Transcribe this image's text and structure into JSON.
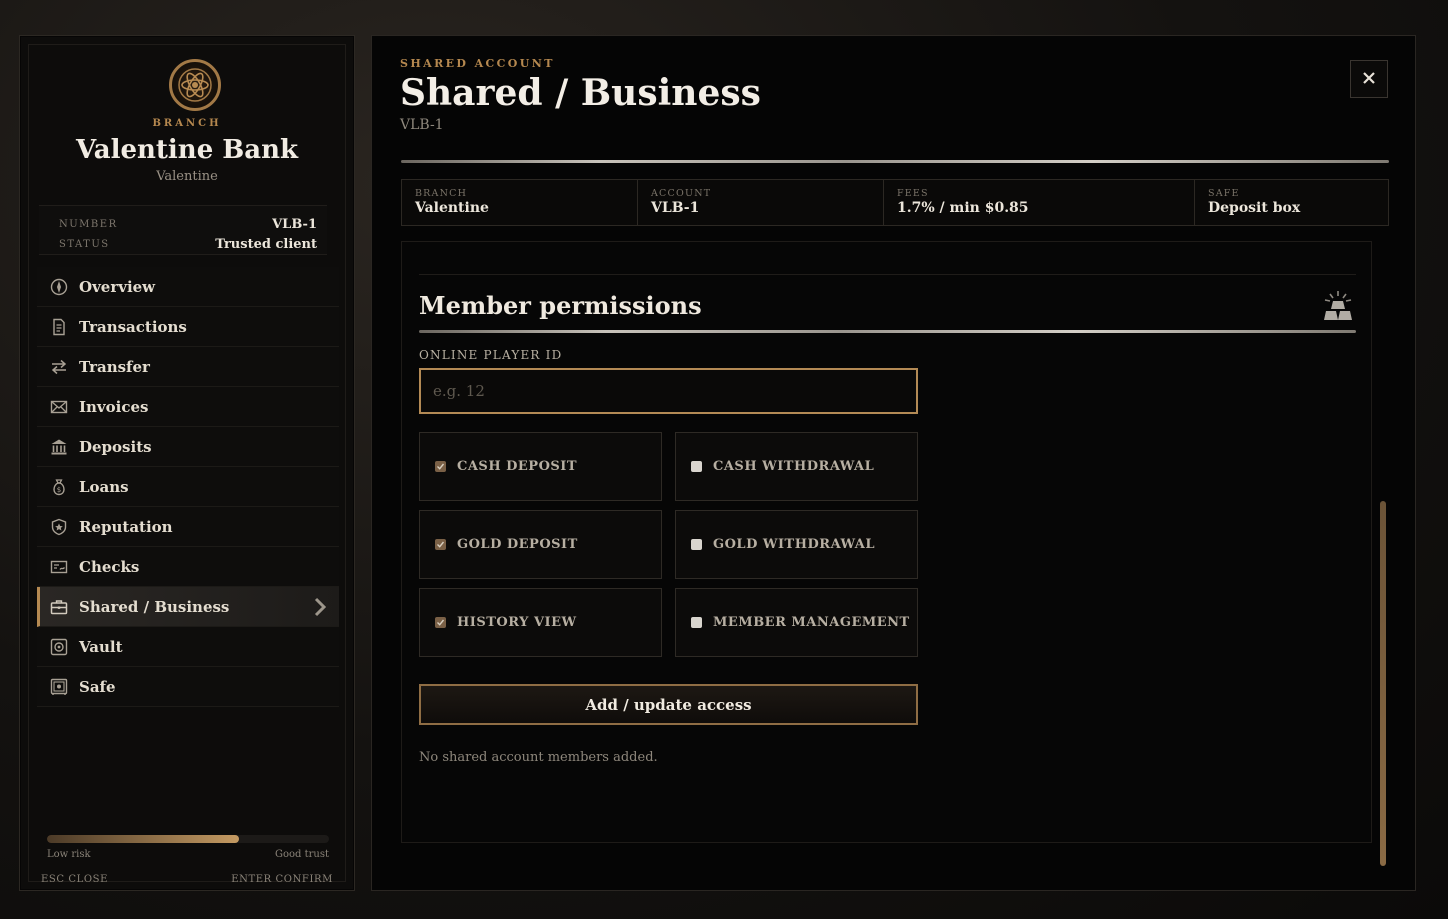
{
  "sidebar": {
    "branch_kicker": "BRANCH",
    "bank_name": "Valentine Bank",
    "city": "Valentine",
    "meta": [
      {
        "key": "NUMBER",
        "value": "VLB-1"
      },
      {
        "key": "STATUS",
        "value": "Trusted client"
      }
    ],
    "items": [
      {
        "label": "Overview",
        "icon": "overview-icon"
      },
      {
        "label": "Transactions",
        "icon": "transactions-icon"
      },
      {
        "label": "Transfer",
        "icon": "transfer-icon"
      },
      {
        "label": "Invoices",
        "icon": "invoices-icon"
      },
      {
        "label": "Deposits",
        "icon": "bank-icon"
      },
      {
        "label": "Loans",
        "icon": "money-bag-icon"
      },
      {
        "label": "Reputation",
        "icon": "shield-icon"
      },
      {
        "label": "Checks",
        "icon": "check-icon"
      },
      {
        "label": "Shared / Business",
        "icon": "briefcase-icon",
        "active": true
      },
      {
        "label": "Vault",
        "icon": "vault-icon"
      },
      {
        "label": "Safe",
        "icon": "safe-icon"
      }
    ],
    "trust": {
      "fill": 0.68,
      "low_label": "Low risk",
      "high_label": "Good trust"
    },
    "hints": {
      "close": "ESC CLOSE",
      "confirm": "ENTER CONFIRM"
    }
  },
  "main": {
    "kicker": "SHARED ACCOUNT",
    "title": "Shared / Business",
    "account_code": "VLB-1",
    "info": [
      {
        "key": "BRANCH",
        "value": "Valentine"
      },
      {
        "key": "ACCOUNT",
        "value": "VLB-1"
      },
      {
        "key": "FEES",
        "value": "1.7% / min $0.85"
      },
      {
        "key": "SAFE",
        "value": "Deposit box"
      }
    ],
    "section_title": "Member permissions",
    "player_id_label": "ONLINE PLAYER ID",
    "player_id_placeholder": "e.g. 12",
    "player_id_value": "",
    "permissions": [
      {
        "label": "CASH DEPOSIT",
        "checked": true
      },
      {
        "label": "CASH WITHDRAWAL",
        "checked": false
      },
      {
        "label": "GOLD DEPOSIT",
        "checked": true
      },
      {
        "label": "GOLD WITHDRAWAL",
        "checked": false
      },
      {
        "label": "HISTORY VIEW",
        "checked": true
      },
      {
        "label": "MEMBER MANAGEMENT",
        "checked": false
      }
    ],
    "submit_label": "Add / update access",
    "empty_note": "No shared account members added."
  },
  "colors": {
    "accent": "#b5884f",
    "panel": "#050505",
    "text": "#e9e2d6"
  }
}
